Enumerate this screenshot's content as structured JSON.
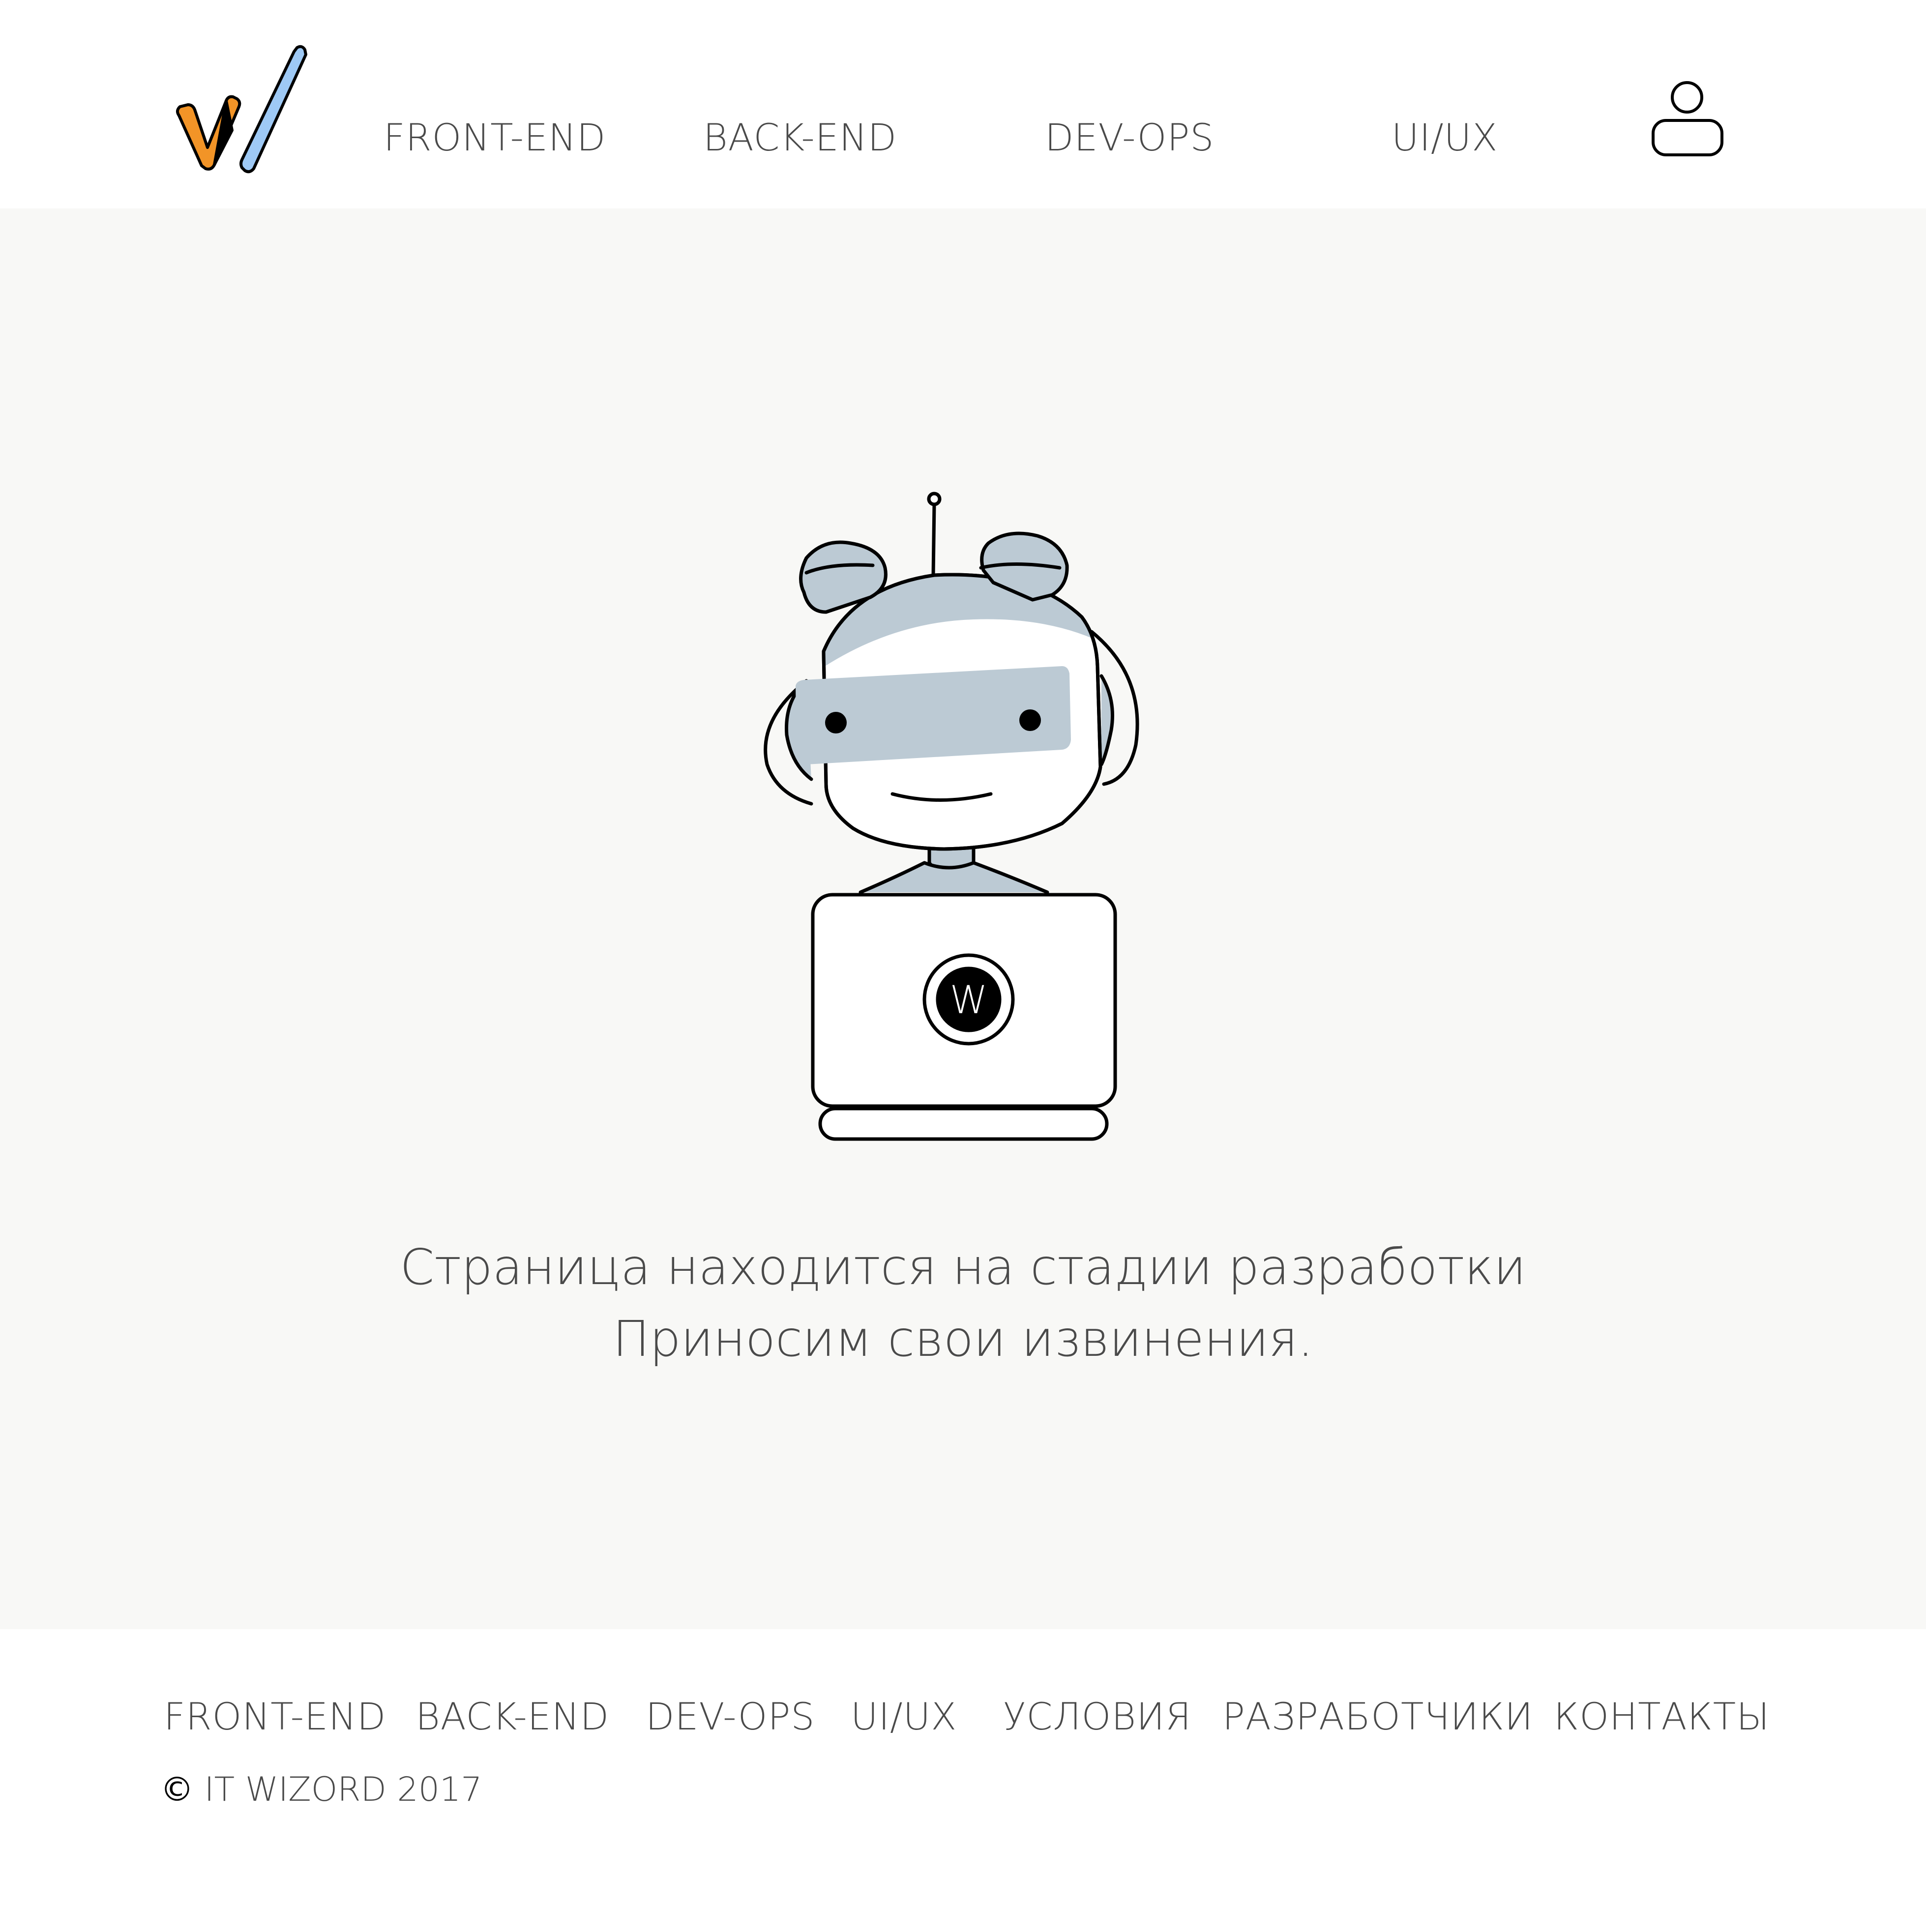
{
  "header": {
    "nav": [
      {
        "label": "FRONT-END"
      },
      {
        "label": "BACK-END"
      },
      {
        "label": "DEV-OPS"
      },
      {
        "label": "UI/UX"
      }
    ],
    "logo_icon": "it-wizord-logo",
    "user_icon": "user-icon"
  },
  "main": {
    "illustration": "robot-with-laptop",
    "laptop_badge": "W",
    "message_line1": "Страница находится на стадии разработки",
    "message_line2": "Приносим свои извинения."
  },
  "footer": {
    "links": [
      {
        "label": "FRONT-END"
      },
      {
        "label": "BACK-END"
      },
      {
        "label": "DEV-OPS"
      },
      {
        "label": "UI/UX"
      },
      {
        "label": "УСЛОВИЯ"
      },
      {
        "label": "РАЗРАБОТЧИКИ"
      },
      {
        "label": "КОНТАКТЫ"
      }
    ],
    "copyright_symbol": "©",
    "copyright_text": "IT WIZORD 2017"
  },
  "colors": {
    "logo_orange": "#f29427",
    "logo_blue": "#9ec9f5",
    "robot_gray": "#bccad4",
    "background_main": "#f8f8f6",
    "text": "#4a4a4a"
  }
}
